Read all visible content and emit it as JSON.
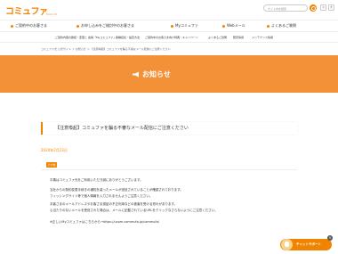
{
  "header": {
    "logo": "コミュファ",
    "logo_sub": "from ctc",
    "search_placeholder": "サイト内を検索",
    "font_small": "小",
    "font_large": "大"
  },
  "nav_main": [
    "ご契約中のお客さま",
    "お申し込みをご検討中のお客さま",
    "Myコミュファ",
    "Webメール",
    "よくあるご質問"
  ],
  "nav_sub": [
    "ご契約内容の確認・変更と 会員「Myコミュファ」",
    "各種接続・設定方法",
    "ご契約中のお客さま向け特典・キャンペーン",
    "よくあるご質問",
    "障害情報",
    "メンテナンス情報"
  ],
  "breadcrumb": "コミュファ光 公式サイト ＞ お知らせ ＞ 【注意喚起】コミュファを騙る不審なメール配信にご注意ください",
  "banner": {
    "title": "お知らせ"
  },
  "article": {
    "title": "【注意喚起】コミュファを騙る不審なメール配信にご注意ください",
    "date": "2020年2月23日",
    "tag": "その他",
    "lines": [
      "平素はコミュファ光をご利用いただき誠にありがとうございます。",
      "当社からの契約変更手続きの通知を装ったメールが送信されていることが確認されております。",
      "フィッシングサイト等で個人情報を入力されませんようご注意ください。",
      "お客さまのメールアドレスやお客さま認証の不正利用などの被害を受ける恐れがあります。",
      "心当たりのないメールを受信された場合は、メールに記載されているURLをクリックなさらないようにご注意ください。",
      "※正しいMyコミュファはこちらから→https://ucom.commufa.jp/commufa/"
    ]
  },
  "chat": {
    "label": "チャットサポート",
    "close": "×"
  }
}
